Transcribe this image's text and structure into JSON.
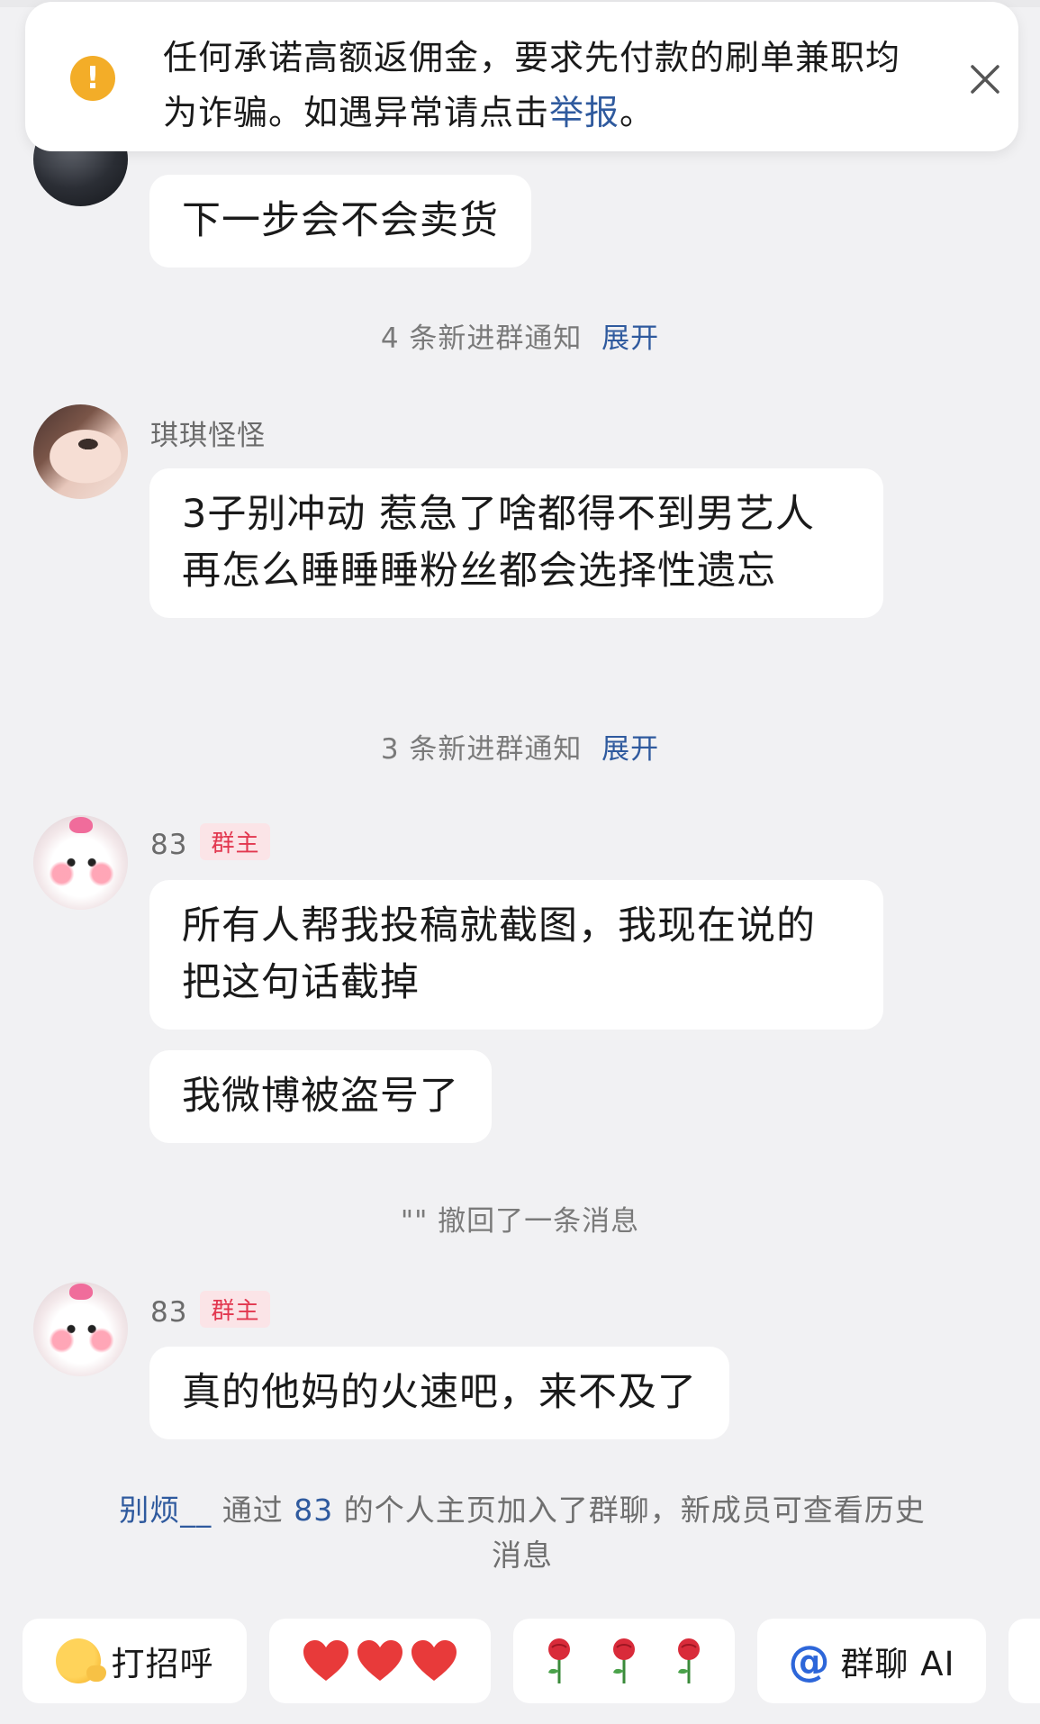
{
  "banner": {
    "icon": "warning-icon",
    "text_before": "任何承诺高额返佣金，要求先付款的刷单兼职均为诈骗。如遇异常请点击",
    "link": "举报",
    "text_after": "。"
  },
  "messages": {
    "m1": {
      "text": "下一步会不会卖货"
    },
    "notice1": {
      "text": "4 条新进群通知",
      "link": "展开"
    },
    "m2": {
      "sender": "琪琪怪怪",
      "text": "3子别冲动 惹急了啥都得不到男艺人再怎么睡睡睡粉丝都会选择性遗忘"
    },
    "notice2": {
      "text": "3 条新进群通知",
      "link": "展开"
    },
    "m3": {
      "sender": "83",
      "badge": "群主",
      "text1": "所有人帮我投稿就截图，我现在说的把这句话截掉",
      "text2": "我微博被盗号了"
    },
    "recall": {
      "text": "\"\" 撤回了一条消息"
    },
    "m4": {
      "sender": "83",
      "badge": "群主",
      "text": "真的他妈的火速吧，来不及了"
    },
    "join": {
      "user": "别烦__",
      "via": " 通过 ",
      "owner": "83",
      "rest": " 的个人主页加入了群聊，新成员可查看历史消息"
    }
  },
  "quick_replies": {
    "greet": {
      "icon": "wave-emoji-icon",
      "label": "打招呼"
    },
    "hearts": {
      "icon": "hearts-emoji-icon"
    },
    "roses": {
      "icon": "roses-emoji-icon"
    },
    "ai": {
      "icon": "at-icon",
      "label": "群聊 AI"
    }
  },
  "colors": {
    "link": "#2f5a9e",
    "badge_text": "#e2374f",
    "warning": "#f3ad28"
  }
}
